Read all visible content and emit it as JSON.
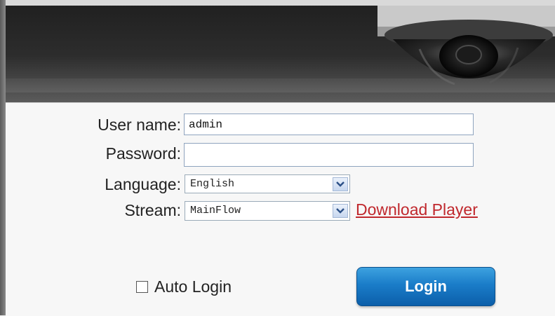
{
  "form": {
    "username_label": "User name:",
    "username_value": "admin",
    "password_label": "Password:",
    "password_value": "",
    "language_label": "Language:",
    "language_value": "English",
    "stream_label": "Stream:",
    "stream_value": "MainFlow",
    "download_link": "Download Player",
    "auto_login_label": "Auto Login",
    "auto_login_checked": false,
    "login_button": "Login"
  },
  "icons": {
    "dropdown": "chevron-down-icon",
    "camera": "dome-camera-icon"
  },
  "colors": {
    "banner": "#2b2b2b",
    "link": "#c0282d",
    "button": "#1a7cc8"
  }
}
